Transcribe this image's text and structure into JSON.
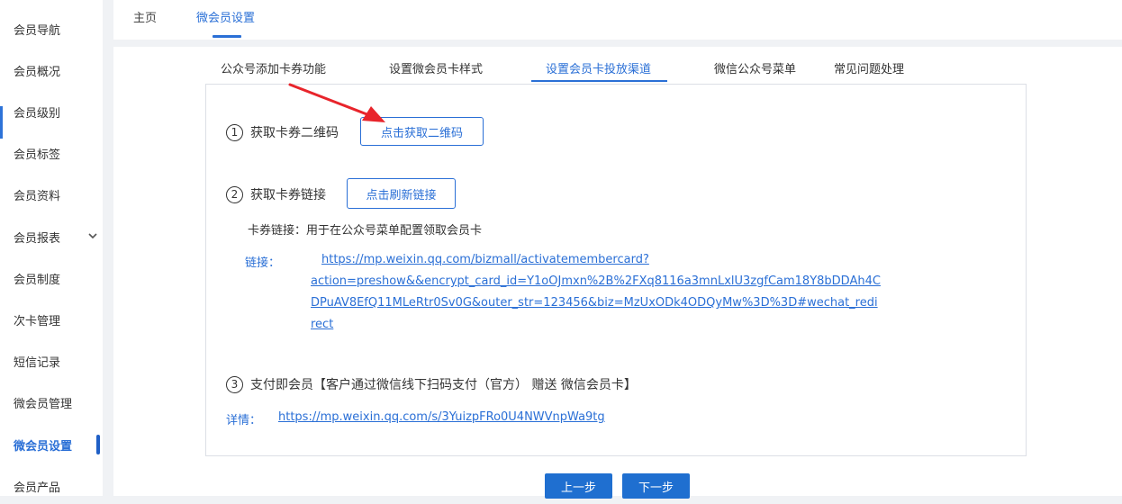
{
  "sidebar": {
    "items": [
      {
        "label": "会员导航"
      },
      {
        "label": "会员概况"
      },
      {
        "label": "会员级别"
      },
      {
        "label": "会员标签"
      },
      {
        "label": "会员资料"
      },
      {
        "label": "会员报表"
      },
      {
        "label": "会员制度"
      },
      {
        "label": "次卡管理"
      },
      {
        "label": "短信记录"
      },
      {
        "label": "微会员管理"
      },
      {
        "label": "微会员设置"
      },
      {
        "label": "会员产品"
      }
    ],
    "active_index": 10
  },
  "top_tabs": [
    {
      "label": "主页"
    },
    {
      "label": "微会员设置"
    }
  ],
  "sub_tabs": [
    {
      "label": "公众号添加卡券功能"
    },
    {
      "label": "设置微会员卡样式"
    },
    {
      "label": "设置会员卡投放渠道"
    },
    {
      "label": "微信公众号菜单"
    },
    {
      "label": "常见问题处理"
    }
  ],
  "panel": {
    "step1": {
      "num": "1",
      "label": "获取卡券二维码",
      "button": "点击获取二维码"
    },
    "step2": {
      "num": "2",
      "label": "获取卡券链接",
      "button": "点击刷新链接",
      "desc": "卡券链接：用于在公众号菜单配置领取会员卡",
      "link_label": "链接：",
      "link_lines": [
        "https://mp.weixin.qq.com/bizmall/activatemembercard?",
        "action=preshow&&encrypt_card_id=Y1oOJmxn%2B%2FXq8116a3mnLxlU3zgfCam18Y8bDDAh4C",
        "DPuAV8EfQ11MLeRtr0Sv0G&outer_str=123456&biz=MzUxODk4ODQyMw%3D%3D#wechat_redi",
        "rect"
      ]
    },
    "step3": {
      "num": "3",
      "label": "支付即会员【客户通过微信线下扫码支付（官方） 赠送 微信会员卡】",
      "link_label": "详情：",
      "link": "https://mp.weixin.qq.com/s/3YuizpFRo0U4NWVnpWa9tg"
    }
  },
  "nav": {
    "prev": "上一步",
    "next": "下一步"
  },
  "colors": {
    "accent": "#2a6fd6",
    "button_fill": "#1f6fd0",
    "arrow": "#e8242b"
  }
}
